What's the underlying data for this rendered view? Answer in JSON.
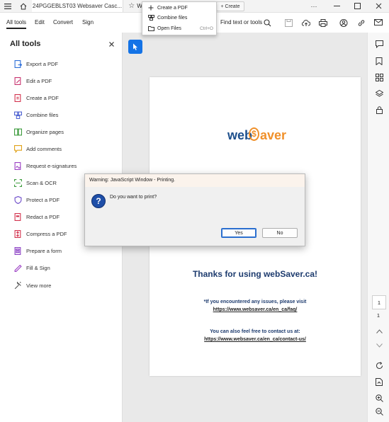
{
  "titlebar": {
    "doc_tab_title": "24PGGEBLST03 Websaver Casc...",
    "second_tab_letter": "W",
    "new_tab_label": "+ Create"
  },
  "dropdown": {
    "items": [
      {
        "label": "Create a PDF",
        "shortcut": "",
        "icon": "plus-icon"
      },
      {
        "label": "Combine files",
        "shortcut": "",
        "icon": "combine-files-icon"
      },
      {
        "label": "Open Files",
        "shortcut": "Ctrl+O",
        "icon": "folder-icon"
      }
    ]
  },
  "toolbar": {
    "tabs": [
      "All tools",
      "Edit",
      "Convert",
      "Sign"
    ],
    "find_label": "Find text or tools"
  },
  "tools_panel": {
    "title": "All tools",
    "items": [
      {
        "label": "Export a PDF",
        "icon": "export-pdf-icon",
        "color": "#2e6fd8"
      },
      {
        "label": "Edit a PDF",
        "icon": "edit-pdf-icon",
        "color": "#c8336f"
      },
      {
        "label": "Create a PDF",
        "icon": "create-pdf-icon",
        "color": "#d3344f"
      },
      {
        "label": "Combine files",
        "icon": "combine-files-icon",
        "color": "#4f63d2"
      },
      {
        "label": "Organize pages",
        "icon": "organize-pages-icon",
        "color": "#3d9b3d"
      },
      {
        "label": "Add comments",
        "icon": "comment-icon",
        "color": "#e0a219"
      },
      {
        "label": "Request e-signatures",
        "icon": "request-signature-icon",
        "color": "#9b3fc4"
      },
      {
        "label": "Scan & OCR",
        "icon": "scan-icon",
        "color": "#3d9b3d"
      },
      {
        "label": "Protect a PDF",
        "icon": "protect-icon",
        "color": "#6a48c9"
      },
      {
        "label": "Redact a PDF",
        "icon": "redact-icon",
        "color": "#d3344f"
      },
      {
        "label": "Compress a PDF",
        "icon": "compress-icon",
        "color": "#d3344f"
      },
      {
        "label": "Prepare a form",
        "icon": "form-icon",
        "color": "#8a3fc4"
      },
      {
        "label": "Fill & Sign",
        "icon": "fill-sign-icon",
        "color": "#9b3fc4"
      },
      {
        "label": "View more",
        "icon": "view-more-icon",
        "color": "#555555"
      }
    ]
  },
  "document": {
    "logo_part1": "web",
    "logo_part2": "aver",
    "logo_colors": {
      "web": "#1d4f8c",
      "saver": "#f0902a"
    },
    "thanks": "Thanks for using webSaver.ca!",
    "issues_line": "*If you encountered any issues, please visit",
    "faq_link": "https://www.websaver.ca/en_ca/faq/",
    "contact_line": "You can also feel free to contact us at:",
    "contact_link": "https://www.websaver.ca/en_ca/contact-us/"
  },
  "right_rail": {
    "page_current": "1",
    "page_total": "1"
  },
  "dialog": {
    "title": "Warning: JavaScript Window - Printing.",
    "message": "Do you want to print?",
    "yes_label": "Yes",
    "no_label": "No"
  }
}
